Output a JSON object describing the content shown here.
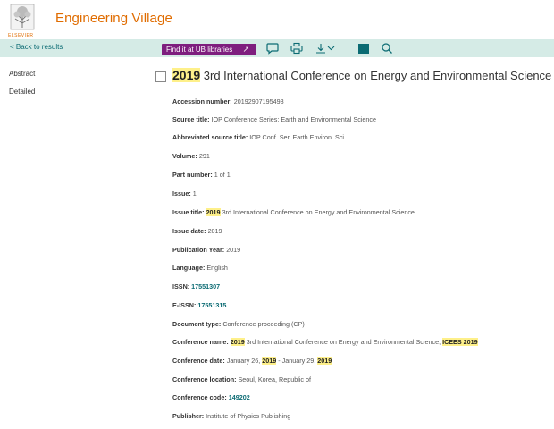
{
  "header": {
    "brand": "Engineering Village",
    "publisher_logo_text": "ELSEVIER"
  },
  "toolbar": {
    "back_label": "< Back to results",
    "find_label": "Find it at UB libraries",
    "find_icon": "external-link-icon",
    "icons": [
      "comment-icon",
      "print-icon",
      "download-icon",
      "folder-icon",
      "search-icon"
    ]
  },
  "nav": {
    "abstract": "Abstract",
    "detailed": "Detailed"
  },
  "record": {
    "title_year": "2019",
    "title_rest": " 3rd International Conference on Energy and Environmental Science",
    "fields": {
      "accession_label": "Accession number:",
      "accession_value": "20192907195498",
      "source_label": "Source title:",
      "source_value": "IOP Conference Series: Earth and Environmental Science",
      "abbr_label": "Abbreviated source title:",
      "abbr_value": "IOP Conf. Ser. Earth Environ. Sci.",
      "volume_label": "Volume:",
      "volume_value": "291",
      "part_label": "Part number:",
      "part_value": "1 of 1",
      "issue_label": "Issue:",
      "issue_value": "1",
      "issue_title_label": "Issue title:",
      "issue_title_year": "2019",
      "issue_title_rest": "3rd International Conference on Energy and Environmental Science",
      "issue_date_label": "Issue date:",
      "issue_date_value": "2019",
      "pub_year_label": "Publication Year:",
      "pub_year_value": "2019",
      "language_label": "Language:",
      "language_value": "English",
      "issn_label": "ISSN:",
      "issn_value": "17551307",
      "eissn_label": "E-ISSN:",
      "eissn_value": "17551315",
      "doctype_label": "Document type:",
      "doctype_value": "Conference proceeding (CP)",
      "conf_name_label": "Conference name:",
      "conf_name_year": "2019",
      "conf_name_rest": "3rd International Conference on Energy and Environmental Science,",
      "conf_name_acronym": "ICEES 2019",
      "conf_date_label": "Conference date:",
      "conf_date_part1": "January 26,",
      "conf_date_year1": "2019",
      "conf_date_part2": "- January 29,",
      "conf_date_year2": "2019",
      "conf_loc_label": "Conference location:",
      "conf_loc_value": "Seoul, Korea, Republic of",
      "conf_code_label": "Conference code:",
      "conf_code_value": "149202",
      "publisher_label": "Publisher:",
      "publisher_value": "Institute of Physics Publishing"
    }
  },
  "colors": {
    "brand_orange": "#e06c00",
    "toolbar_bg": "#d5ebe6",
    "find_button_bg": "#7e1e7e",
    "link_teal": "#0b6b73",
    "highlight": "#fef08a"
  }
}
